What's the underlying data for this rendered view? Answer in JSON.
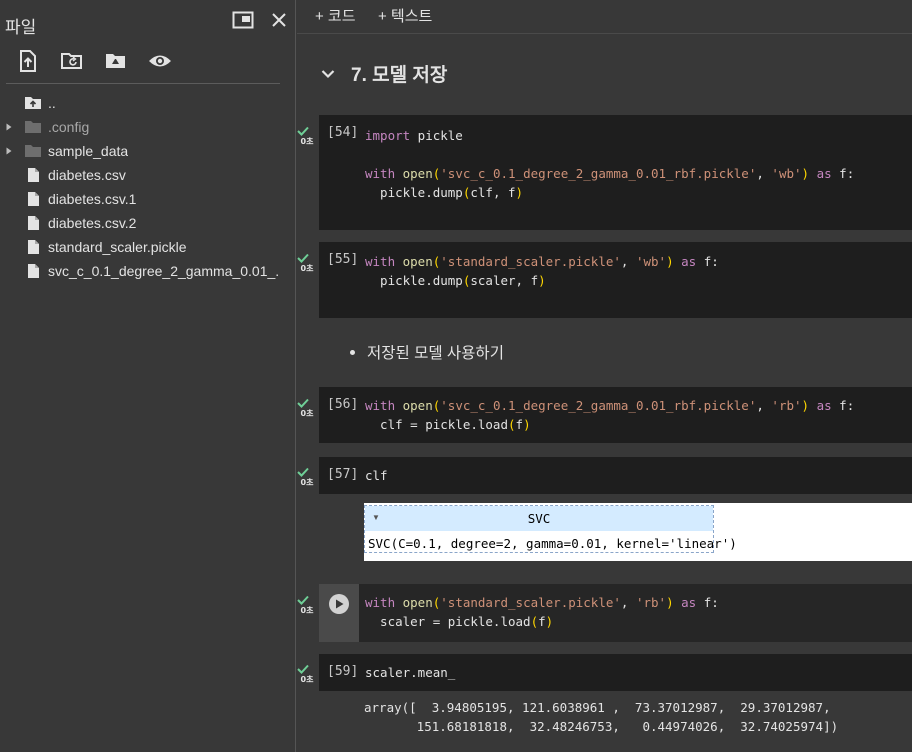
{
  "sidebar": {
    "title": "파일",
    "tree": [
      {
        "name": "..",
        "kind": "parent",
        "expandable": false,
        "dim": false
      },
      {
        "name": ".config",
        "kind": "folder",
        "expandable": true,
        "dim": true
      },
      {
        "name": "sample_data",
        "kind": "folder",
        "expandable": true,
        "dim": false
      },
      {
        "name": "diabetes.csv",
        "kind": "file",
        "expandable": false,
        "dim": false
      },
      {
        "name": "diabetes.csv.1",
        "kind": "file",
        "expandable": false,
        "dim": false
      },
      {
        "name": "diabetes.csv.2",
        "kind": "file",
        "expandable": false,
        "dim": false
      },
      {
        "name": "standard_scaler.pickle",
        "kind": "file",
        "expandable": false,
        "dim": false
      },
      {
        "name": "svc_c_0.1_degree_2_gamma_0.01_...",
        "kind": "file",
        "expandable": false,
        "dim": false
      }
    ]
  },
  "topbar": {
    "add_code": "+ 코드",
    "add_text": "+ 텍스트"
  },
  "section": {
    "title": "7. 모델 저장"
  },
  "cells": {
    "c54": {
      "exec": "[54]",
      "time": "0초",
      "line1_kw": "import",
      "line1_rest": " pickle",
      "line3_kw1": "with",
      "line3_fn": " open",
      "line3_p1": "(",
      "line3_str1": "'svc_c_0.1_degree_2_gamma_0.01_rbf.pickle'",
      "line3_comma": ", ",
      "line3_str2": "'wb'",
      "line3_p2": ")",
      "line3_kw2": " as",
      "line3_end": " f:",
      "line4_a": "  pickle.dump",
      "line4_p1": "(",
      "line4_b": "clf, f",
      "line4_p2": ")"
    },
    "c55": {
      "exec": "[55]",
      "time": "0초",
      "line1_kw1": "with",
      "line1_fn": " open",
      "line1_p1": "(",
      "line1_str1": "'standard_scaler.pickle'",
      "line1_comma": ", ",
      "line1_str2": "'wb'",
      "line1_p2": ")",
      "line1_kw2": " as",
      "line1_end": " f:",
      "line2_a": "  pickle.dump",
      "line2_p1": "(",
      "line2_b": "scaler, f",
      "line2_p2": ")"
    },
    "bullet": "저장된 모델 사용하기",
    "c56": {
      "exec": "[56]",
      "time": "0초",
      "line1_kw1": "with",
      "line1_fn": " open",
      "line1_p1": "(",
      "line1_str1": "'svc_c_0.1_degree_2_gamma_0.01_rbf.pickle'",
      "line1_comma": ", ",
      "line1_str2": "'rb'",
      "line1_p2": ")",
      "line1_kw2": " as",
      "line1_end": " f:",
      "line2_a": "  clf = pickle.load",
      "line2_p1": "(",
      "line2_b": "f",
      "line2_p2": ")"
    },
    "c57": {
      "exec": "[57]",
      "time": "0초",
      "code": "clf",
      "svc_title": "SVC",
      "svc_repr": "SVC(C=0.1, degree=2, gamma=0.01, kernel='linear')"
    },
    "c58": {
      "time": "0초",
      "line1_kw1": "with",
      "line1_fn": " open",
      "line1_p1": "(",
      "line1_str1": "'standard_scaler.pickle'",
      "line1_comma": ", ",
      "line1_str2": "'rb'",
      "line1_p2": ")",
      "line1_kw2": " as",
      "line1_end": " f:",
      "line2_a": "  scaler = pickle.load",
      "line2_p1": "(",
      "line2_b": "f",
      "line2_p2": ")"
    },
    "c59": {
      "exec": "[59]",
      "time": "0초",
      "code": "scaler.mean_",
      "output_line1": "array([  3.94805195, 121.6038961 ,  73.37012987,  29.37012987,",
      "output_line2": "       151.68181818,  32.48246753,   0.44974026,  32.74025974])"
    }
  },
  "colors": {
    "background": "#383838",
    "cell": "#1e1e1e",
    "keyword": "#c586c0",
    "string": "#ce9178",
    "function": "#dcdcaa",
    "check": "#6fcf97"
  }
}
